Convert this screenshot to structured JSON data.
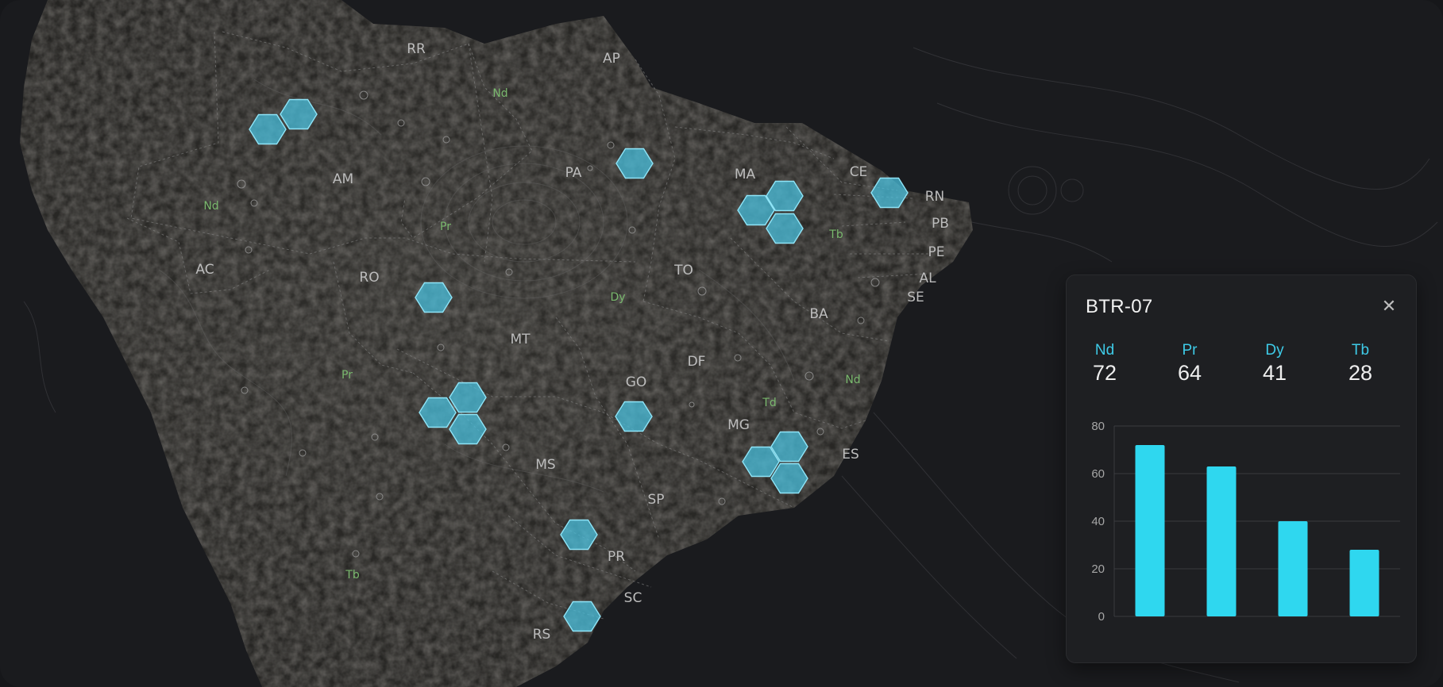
{
  "map": {
    "states": [
      "RR",
      "AP",
      "AM",
      "PA",
      "MA",
      "CE",
      "RN",
      "PB",
      "PE",
      "AL",
      "SE",
      "AC",
      "RO",
      "TO",
      "BA",
      "MT",
      "DF",
      "GO",
      "MG",
      "ES",
      "MS",
      "SP",
      "PR",
      "SC",
      "RS"
    ],
    "minerals": [
      "Nd",
      "Nd",
      "Pr",
      "Tb",
      "Dy",
      "Pr",
      "Nd",
      "Td",
      "Tb"
    ]
  },
  "panel": {
    "title": "BTR-07",
    "close_icon": "close-icon",
    "stats": [
      {
        "symbol": "Nd",
        "value": "72"
      },
      {
        "symbol": "Pr",
        "value": "64"
      },
      {
        "symbol": "Dy",
        "value": "41"
      },
      {
        "symbol": "Tb",
        "value": "28"
      }
    ]
  },
  "chart_data": {
    "type": "bar",
    "categories": [
      "Nd",
      "Pr",
      "Dy",
      "Tb"
    ],
    "values": [
      72,
      63,
      40,
      28
    ],
    "title": "",
    "xlabel": "",
    "ylabel": "",
    "ylim": [
      0,
      80
    ],
    "yticks": [
      "80",
      "60",
      "40",
      "20",
      "0"
    ],
    "grid": true,
    "color": "#2fd7ef"
  },
  "colors": {
    "background": "#1a1b1e",
    "land": "#2a2927",
    "hex_fill": "#4ac4e2",
    "accent": "#3ecbe8",
    "mineral_label": "#79b86d"
  }
}
